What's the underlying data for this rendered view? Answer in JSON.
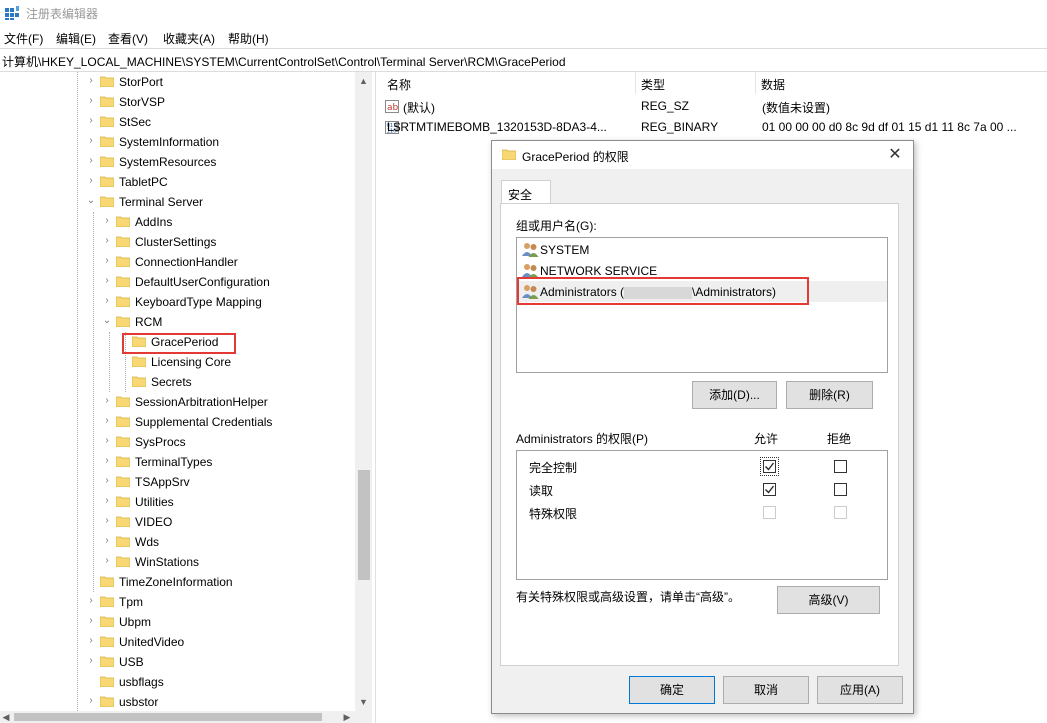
{
  "window": {
    "title": "注册表编辑器"
  },
  "menu": [
    "文件(F)",
    "编辑(E)",
    "查看(V)",
    "收藏夹(A)",
    "帮助(H)"
  ],
  "address": "计算机\\HKEY_LOCAL_MACHINE\\SYSTEM\\CurrentControlSet\\Control\\Terminal Server\\RCM\\GracePeriod",
  "tree": {
    "items": [
      "StorPort",
      "StorVSP",
      "StSec",
      "SystemInformation",
      "SystemResources",
      "TabletPC",
      "Terminal Server",
      "AddIns",
      "ClusterSettings",
      "ConnectionHandler",
      "DefaultUserConfiguration",
      "KeyboardType Mapping",
      "RCM",
      "GracePeriod",
      "Licensing Core",
      "Secrets",
      "SessionArbitrationHelper",
      "Supplemental Credentials",
      "SysProcs",
      "TerminalTypes",
      "TSAppSrv",
      "Utilities",
      "VIDEO",
      "Wds",
      "WinStations",
      "TimeZoneInformation",
      "Tpm",
      "Ubpm",
      "UnitedVideo",
      "USB",
      "usbflags",
      "usbstor"
    ]
  },
  "list": {
    "headers": {
      "name": "名称",
      "type": "类型",
      "data": "数据"
    },
    "rows": [
      {
        "name": "(默认)",
        "type": "REG_SZ",
        "data": "(数值未设置)",
        "icon": "string-value-icon"
      },
      {
        "name": "L$RTMTIMEBOMB_1320153D-8DA3-4...",
        "type": "REG_BINARY",
        "data": "01 00 00 00 d0 8c 9d df 01 15 d1 11 8c 7a 00 ...",
        "icon": "binary-value-icon"
      }
    ]
  },
  "dialog": {
    "title": "GracePeriod 的权限",
    "tab": "安全",
    "group_label": "组或用户名(G):",
    "users": [
      "SYSTEM",
      "NETWORK SERVICE"
    ],
    "admin_user": {
      "prefix": "Administrators (",
      "suffix": "\\Administrators)"
    },
    "add_button": "添加(D)...",
    "remove_button": "删除(R)",
    "perm_label": "Administrators 的权限(P)",
    "allow_header": "允许",
    "deny_header": "拒绝",
    "permissions": [
      {
        "name": "完全控制",
        "allow": true,
        "deny": false,
        "disabled": false
      },
      {
        "name": "读取",
        "allow": true,
        "deny": false,
        "disabled": false
      },
      {
        "name": "特殊权限",
        "allow": false,
        "deny": false,
        "disabled": true
      }
    ],
    "hint": "有关特殊权限或高级设置，请单击“高级”。",
    "advanced_button": "高级(V)",
    "ok_button": "确定",
    "cancel_button": "取消",
    "apply_button": "应用(A)",
    "accent": "#0078d7",
    "highlight": "#e53935"
  }
}
